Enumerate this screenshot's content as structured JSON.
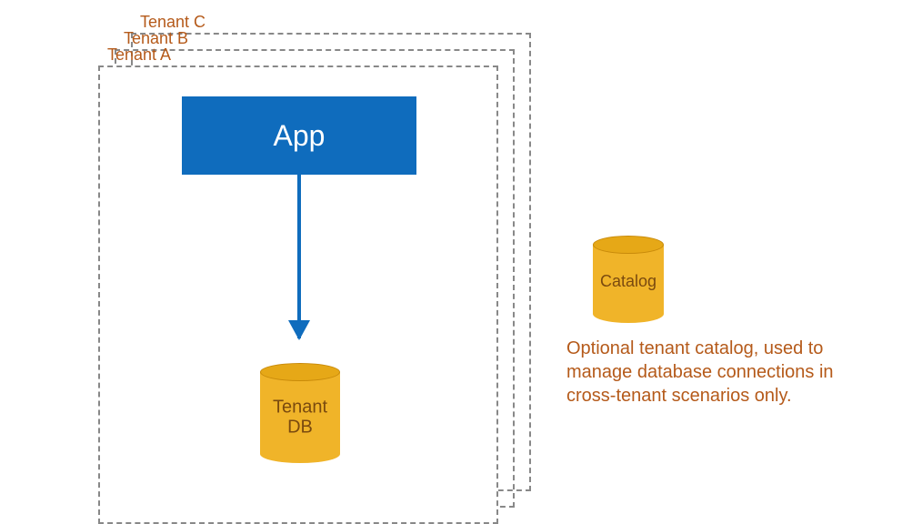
{
  "tenants": {
    "c": {
      "label": "Tenant C"
    },
    "b": {
      "label": "Tenant B"
    },
    "a": {
      "label": "Tenant A"
    }
  },
  "app": {
    "label": "App"
  },
  "tenant_db": {
    "label_line1": "Tenant",
    "label_line2": "DB"
  },
  "catalog": {
    "label": "Catalog",
    "description": "Optional tenant catalog, used to manage database connections in cross-tenant scenarios only."
  },
  "colors": {
    "app_bg": "#0f6cbd",
    "cylinder": "#f0b429",
    "text_accent": "#b55a1a",
    "border": "#888888"
  }
}
